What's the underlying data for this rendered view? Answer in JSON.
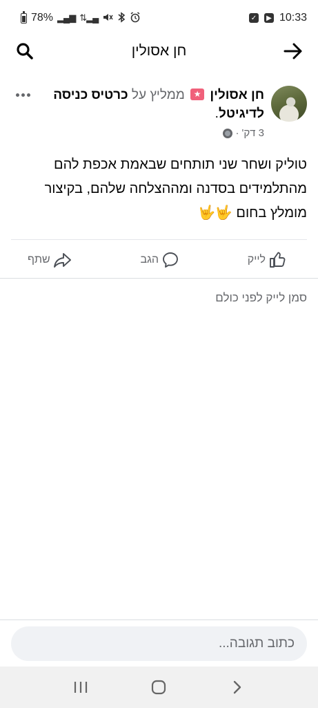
{
  "status_bar": {
    "battery": "78%",
    "time": "10:33"
  },
  "header": {
    "title": "חן אסולין",
    "back_icon": "arrow-right-icon",
    "search_icon": "search-icon"
  },
  "post": {
    "author": "חן אסולין",
    "badge_icon": "recommend-star-icon",
    "recommends_text": "ממליץ על",
    "page_name": "כרטיס כניסה לדיגיטל",
    "period": ".",
    "time_ago": "3 דק'",
    "separator": "·",
    "body": "טוליק ושחר שני תותחים שבאמת אכפת להם מהתלמידים בסדנה ומההצלחה שלהם, בקיצור מומלץ בחום 🤟🤟"
  },
  "actions": {
    "like": "לייק",
    "comment": "הגב",
    "share": "שתף"
  },
  "first_like": "סמן לייק לפני כולם",
  "comment_box": {
    "placeholder": "כתוב תגובה..."
  },
  "colors": {
    "badge": "#f0607a",
    "muted": "#65676b",
    "input_bg": "#f0f2f5"
  }
}
